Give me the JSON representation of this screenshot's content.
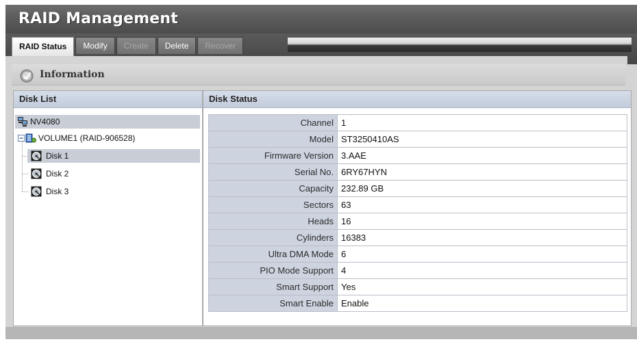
{
  "app": {
    "title": "RAID Management"
  },
  "tabs": [
    {
      "label": "RAID Status",
      "state": "active"
    },
    {
      "label": "Modify",
      "state": "normal"
    },
    {
      "label": "Create",
      "state": "disabled"
    },
    {
      "label": "Delete",
      "state": "normal"
    },
    {
      "label": "Recover",
      "state": "disabled"
    }
  ],
  "section": {
    "title": "Information",
    "icon": "info-disc-icon"
  },
  "disk_list": {
    "header": "Disk List",
    "host": {
      "label": "NV4080",
      "icon": "network-computer-icon"
    },
    "volume": {
      "label": "VOLUME1 (RAID-906528)",
      "icon": "raid-volume-icon",
      "expander": "minus"
    },
    "disks": [
      {
        "label": "Disk 1",
        "icon": "hard-disk-icon",
        "selected": true
      },
      {
        "label": "Disk 2",
        "icon": "hard-disk-icon",
        "selected": false
      },
      {
        "label": "Disk 3",
        "icon": "hard-disk-icon",
        "selected": false
      }
    ]
  },
  "disk_status": {
    "header": "Disk Status",
    "rows": [
      {
        "key": "Channel",
        "value": "1"
      },
      {
        "key": "Model",
        "value": "ST3250410AS"
      },
      {
        "key": "Firmware Version",
        "value": "3.AAE"
      },
      {
        "key": "Serial No.",
        "value": "6RY67HYN"
      },
      {
        "key": "Capacity",
        "value": "232.89 GB"
      },
      {
        "key": "Sectors",
        "value": "63"
      },
      {
        "key": "Heads",
        "value": "16"
      },
      {
        "key": "Cylinders",
        "value": "16383"
      },
      {
        "key": "Ultra DMA Mode",
        "value": "6"
      },
      {
        "key": "PIO Mode Support",
        "value": "4"
      },
      {
        "key": "Smart Support",
        "value": "Yes"
      },
      {
        "key": "Smart Enable",
        "value": "Enable"
      }
    ]
  },
  "colors": {
    "titlebar": "#5c5c5c",
    "panel_header": "#c8d0de",
    "key_cell": "#cdd3df",
    "selected_row": "#c8cdd6"
  }
}
